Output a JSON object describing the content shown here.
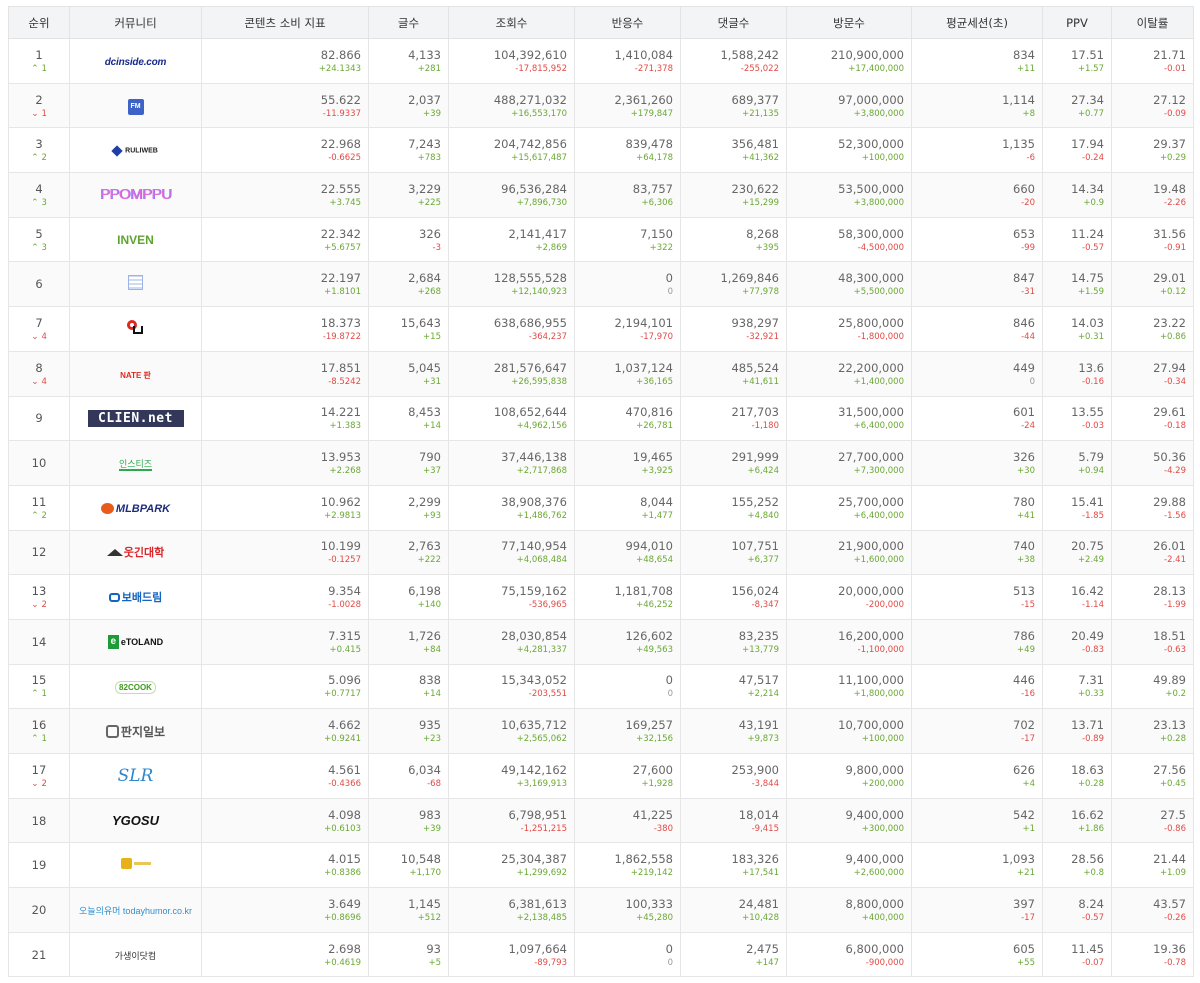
{
  "headers": [
    "순위",
    "커뮤니티",
    "콘텐츠 소비 지표",
    "글수",
    "조회수",
    "반응수",
    "댓글수",
    "방문수",
    "평균세션(초)",
    "PPV",
    "이탈률"
  ],
  "rows": [
    {
      "rank": "1",
      "chg": "1",
      "dir": "up",
      "logo": "dcinside.com",
      "vals": [
        [
          "82.866",
          "+24.1343",
          "u"
        ],
        [
          "4,133",
          "+281",
          "u"
        ],
        [
          "104,392,610",
          "-17,815,952",
          "d"
        ],
        [
          "1,410,084",
          "-271,378",
          "d"
        ],
        [
          "1,588,242",
          "-255,022",
          "d"
        ],
        [
          "210,900,000",
          "+17,400,000",
          "u"
        ],
        [
          "834",
          "+11",
          "u"
        ],
        [
          "17.51",
          "+1.57",
          "u"
        ],
        [
          "21.71",
          "-0.01",
          "d"
        ]
      ]
    },
    {
      "rank": "2",
      "chg": "1",
      "dir": "dn",
      "logo": "FM",
      "vals": [
        [
          "55.622",
          "-11.9337",
          "d"
        ],
        [
          "2,037",
          "+39",
          "u"
        ],
        [
          "488,271,032",
          "+16,553,170",
          "u"
        ],
        [
          "2,361,260",
          "+179,847",
          "u"
        ],
        [
          "689,377",
          "+21,135",
          "u"
        ],
        [
          "97,000,000",
          "+3,800,000",
          "u"
        ],
        [
          "1,114",
          "+8",
          "u"
        ],
        [
          "27.34",
          "+0.77",
          "u"
        ],
        [
          "27.12",
          "-0.09",
          "d"
        ]
      ]
    },
    {
      "rank": "3",
      "chg": "2",
      "dir": "up",
      "logo": "RULIWEB",
      "vals": [
        [
          "22.968",
          "-0.6625",
          "d"
        ],
        [
          "7,243",
          "+783",
          "u"
        ],
        [
          "204,742,856",
          "+15,617,487",
          "u"
        ],
        [
          "839,478",
          "+64,178",
          "u"
        ],
        [
          "356,481",
          "+41,362",
          "u"
        ],
        [
          "52,300,000",
          "+100,000",
          "u"
        ],
        [
          "1,135",
          "-6",
          "d"
        ],
        [
          "17.94",
          "-0.24",
          "d"
        ],
        [
          "29.37",
          "+0.29",
          "u"
        ]
      ]
    },
    {
      "rank": "4",
      "chg": "3",
      "dir": "up",
      "logo": "PPOMPPU",
      "vals": [
        [
          "22.555",
          "+3.745",
          "u"
        ],
        [
          "3,229",
          "+225",
          "u"
        ],
        [
          "96,536,284",
          "+7,896,730",
          "u"
        ],
        [
          "83,757",
          "+6,306",
          "u"
        ],
        [
          "230,622",
          "+15,299",
          "u"
        ],
        [
          "53,500,000",
          "+3,800,000",
          "u"
        ],
        [
          "660",
          "-20",
          "d"
        ],
        [
          "14.34",
          "+0.9",
          "u"
        ],
        [
          "19.48",
          "-2.26",
          "d"
        ]
      ]
    },
    {
      "rank": "5",
      "chg": "3",
      "dir": "up",
      "logo": "INVEN",
      "vals": [
        [
          "22.342",
          "+5.6757",
          "u"
        ],
        [
          "326",
          "-3",
          "d"
        ],
        [
          "2,141,417",
          "+2,869",
          "u"
        ],
        [
          "7,150",
          "+322",
          "u"
        ],
        [
          "8,268",
          "+395",
          "u"
        ],
        [
          "58,300,000",
          "-4,500,000",
          "d"
        ],
        [
          "653",
          "-99",
          "d"
        ],
        [
          "11.24",
          "-0.57",
          "d"
        ],
        [
          "31.56",
          "-0.91",
          "d"
        ]
      ]
    },
    {
      "rank": "6",
      "chg": "",
      "dir": "",
      "logo": "",
      "vals": [
        [
          "22.197",
          "+1.8101",
          "u"
        ],
        [
          "2,684",
          "+268",
          "u"
        ],
        [
          "128,555,528",
          "+12,140,923",
          "u"
        ],
        [
          "0",
          "0",
          "z"
        ],
        [
          "1,269,846",
          "+77,978",
          "u"
        ],
        [
          "48,300,000",
          "+5,500,000",
          "u"
        ],
        [
          "847",
          "-31",
          "d"
        ],
        [
          "14.75",
          "+1.59",
          "u"
        ],
        [
          "29.01",
          "+0.12",
          "u"
        ]
      ]
    },
    {
      "rank": "7",
      "chg": "4",
      "dir": "dn",
      "logo": "",
      "vals": [
        [
          "18.373",
          "-19.8722",
          "d"
        ],
        [
          "15,643",
          "+15",
          "u"
        ],
        [
          "638,686,955",
          "-364,237",
          "d"
        ],
        [
          "2,194,101",
          "-17,970",
          "d"
        ],
        [
          "938,297",
          "-32,921",
          "d"
        ],
        [
          "25,800,000",
          "-1,800,000",
          "d"
        ],
        [
          "846",
          "-44",
          "d"
        ],
        [
          "14.03",
          "+0.31",
          "u"
        ],
        [
          "23.22",
          "+0.86",
          "u"
        ]
      ]
    },
    {
      "rank": "8",
      "chg": "4",
      "dir": "dn",
      "logo": "NATE 판",
      "vals": [
        [
          "17.851",
          "-8.5242",
          "d"
        ],
        [
          "5,045",
          "+31",
          "u"
        ],
        [
          "281,576,647",
          "+26,595,838",
          "u"
        ],
        [
          "1,037,124",
          "+36,165",
          "u"
        ],
        [
          "485,524",
          "+41,611",
          "u"
        ],
        [
          "22,200,000",
          "+1,400,000",
          "u"
        ],
        [
          "449",
          "0",
          "z"
        ],
        [
          "13.6",
          "-0.16",
          "d"
        ],
        [
          "27.94",
          "-0.34",
          "d"
        ]
      ]
    },
    {
      "rank": "9",
      "chg": "",
      "dir": "",
      "logo": "CLIEN.net",
      "vals": [
        [
          "14.221",
          "+1.383",
          "u"
        ],
        [
          "8,453",
          "+14",
          "u"
        ],
        [
          "108,652,644",
          "+4,962,156",
          "u"
        ],
        [
          "470,816",
          "+26,781",
          "u"
        ],
        [
          "217,703",
          "-1,180",
          "d"
        ],
        [
          "31,500,000",
          "+6,400,000",
          "u"
        ],
        [
          "601",
          "-24",
          "d"
        ],
        [
          "13.55",
          "-0.03",
          "d"
        ],
        [
          "29.61",
          "-0.18",
          "d"
        ]
      ]
    },
    {
      "rank": "10",
      "chg": "",
      "dir": "",
      "logo": "인스티즈",
      "vals": [
        [
          "13.953",
          "+2.268",
          "u"
        ],
        [
          "790",
          "+37",
          "u"
        ],
        [
          "37,446,138",
          "+2,717,868",
          "u"
        ],
        [
          "19,465",
          "+3,925",
          "u"
        ],
        [
          "291,999",
          "+6,424",
          "u"
        ],
        [
          "27,700,000",
          "+7,300,000",
          "u"
        ],
        [
          "326",
          "+30",
          "u"
        ],
        [
          "5.79",
          "+0.94",
          "u"
        ],
        [
          "50.36",
          "-4.29",
          "d"
        ]
      ]
    },
    {
      "rank": "11",
      "chg": "2",
      "dir": "up",
      "logo": "MLBPARK",
      "vals": [
        [
          "10.962",
          "+2.9813",
          "u"
        ],
        [
          "2,299",
          "+93",
          "u"
        ],
        [
          "38,908,376",
          "+1,486,762",
          "u"
        ],
        [
          "8,044",
          "+1,477",
          "u"
        ],
        [
          "155,252",
          "+4,840",
          "u"
        ],
        [
          "25,700,000",
          "+6,400,000",
          "u"
        ],
        [
          "780",
          "+41",
          "u"
        ],
        [
          "15.41",
          "-1.85",
          "d"
        ],
        [
          "29.88",
          "-1.56",
          "d"
        ]
      ]
    },
    {
      "rank": "12",
      "chg": "",
      "dir": "",
      "logo": "웃긴대학",
      "vals": [
        [
          "10.199",
          "-0.1257",
          "d"
        ],
        [
          "2,763",
          "+222",
          "u"
        ],
        [
          "77,140,954",
          "+4,068,484",
          "u"
        ],
        [
          "994,010",
          "+48,654",
          "u"
        ],
        [
          "107,751",
          "+6,377",
          "u"
        ],
        [
          "21,900,000",
          "+1,600,000",
          "u"
        ],
        [
          "740",
          "+38",
          "u"
        ],
        [
          "20.75",
          "+2.49",
          "u"
        ],
        [
          "26.01",
          "-2.41",
          "d"
        ]
      ]
    },
    {
      "rank": "13",
      "chg": "2",
      "dir": "dn",
      "logo": "보배드림",
      "vals": [
        [
          "9.354",
          "-1.0028",
          "d"
        ],
        [
          "6,198",
          "+140",
          "u"
        ],
        [
          "75,159,162",
          "-536,965",
          "d"
        ],
        [
          "1,181,708",
          "+46,252",
          "u"
        ],
        [
          "156,024",
          "-8,347",
          "d"
        ],
        [
          "20,000,000",
          "-200,000",
          "d"
        ],
        [
          "513",
          "-15",
          "d"
        ],
        [
          "16.42",
          "-1.14",
          "d"
        ],
        [
          "28.13",
          "-1.99",
          "d"
        ]
      ]
    },
    {
      "rank": "14",
      "chg": "",
      "dir": "",
      "logo": "eTOLAND",
      "vals": [
        [
          "7.315",
          "+0.415",
          "u"
        ],
        [
          "1,726",
          "+84",
          "u"
        ],
        [
          "28,030,854",
          "+4,281,337",
          "u"
        ],
        [
          "126,602",
          "+49,563",
          "u"
        ],
        [
          "83,235",
          "+13,779",
          "u"
        ],
        [
          "16,200,000",
          "-1,100,000",
          "d"
        ],
        [
          "786",
          "+49",
          "u"
        ],
        [
          "20.49",
          "-0.83",
          "d"
        ],
        [
          "18.51",
          "-0.63",
          "d"
        ]
      ]
    },
    {
      "rank": "15",
      "chg": "1",
      "dir": "up",
      "logo": "82COOK",
      "vals": [
        [
          "5.096",
          "+0.7717",
          "u"
        ],
        [
          "838",
          "+14",
          "u"
        ],
        [
          "15,343,052",
          "-203,551",
          "d"
        ],
        [
          "0",
          "0",
          "z"
        ],
        [
          "47,517",
          "+2,214",
          "u"
        ],
        [
          "11,100,000",
          "+1,800,000",
          "u"
        ],
        [
          "446",
          "-16",
          "d"
        ],
        [
          "7.31",
          "+0.33",
          "u"
        ],
        [
          "49.89",
          "+0.2",
          "u"
        ]
      ]
    },
    {
      "rank": "16",
      "chg": "1",
      "dir": "up",
      "logo": "판지일보",
      "vals": [
        [
          "4.662",
          "+0.9241",
          "u"
        ],
        [
          "935",
          "+23",
          "u"
        ],
        [
          "10,635,712",
          "+2,565,062",
          "u"
        ],
        [
          "169,257",
          "+32,156",
          "u"
        ],
        [
          "43,191",
          "+9,873",
          "u"
        ],
        [
          "10,700,000",
          "+100,000",
          "u"
        ],
        [
          "702",
          "-17",
          "d"
        ],
        [
          "13.71",
          "-0.89",
          "d"
        ],
        [
          "23.13",
          "+0.28",
          "u"
        ]
      ]
    },
    {
      "rank": "17",
      "chg": "2",
      "dir": "dn",
      "logo": "SLR",
      "vals": [
        [
          "4.561",
          "-0.4366",
          "d"
        ],
        [
          "6,034",
          "-68",
          "d"
        ],
        [
          "49,142,162",
          "+3,169,913",
          "u"
        ],
        [
          "27,600",
          "+1,928",
          "u"
        ],
        [
          "253,900",
          "-3,844",
          "d"
        ],
        [
          "9,800,000",
          "+200,000",
          "u"
        ],
        [
          "626",
          "+4",
          "u"
        ],
        [
          "18.63",
          "+0.28",
          "u"
        ],
        [
          "27.56",
          "+0.45",
          "u"
        ]
      ]
    },
    {
      "rank": "18",
      "chg": "",
      "dir": "",
      "logo": "YGOSU",
      "vals": [
        [
          "4.098",
          "+0.6103",
          "u"
        ],
        [
          "983",
          "+39",
          "u"
        ],
        [
          "6,798,951",
          "-1,251,215",
          "d"
        ],
        [
          "41,225",
          "-380",
          "d"
        ],
        [
          "18,014",
          "-9,415",
          "d"
        ],
        [
          "9,400,000",
          "+300,000",
          "u"
        ],
        [
          "542",
          "+1",
          "u"
        ],
        [
          "16.62",
          "+1.86",
          "u"
        ],
        [
          "27.5",
          "-0.86",
          "d"
        ]
      ]
    },
    {
      "rank": "19",
      "chg": "",
      "dir": "",
      "logo": "",
      "vals": [
        [
          "4.015",
          "+0.8386",
          "u"
        ],
        [
          "10,548",
          "+1,170",
          "u"
        ],
        [
          "25,304,387",
          "+1,299,692",
          "u"
        ],
        [
          "1,862,558",
          "+219,142",
          "u"
        ],
        [
          "183,326",
          "+17,541",
          "u"
        ],
        [
          "9,400,000",
          "+2,600,000",
          "u"
        ],
        [
          "1,093",
          "+21",
          "u"
        ],
        [
          "28.56",
          "+0.8",
          "u"
        ],
        [
          "21.44",
          "+1.09",
          "u"
        ]
      ]
    },
    {
      "rank": "20",
      "chg": "",
      "dir": "",
      "logo": "오늘의유머 todayhumor.co.kr",
      "vals": [
        [
          "3.649",
          "+0.8696",
          "u"
        ],
        [
          "1,145",
          "+512",
          "u"
        ],
        [
          "6,381,613",
          "+2,138,485",
          "u"
        ],
        [
          "100,333",
          "+45,280",
          "u"
        ],
        [
          "24,481",
          "+10,428",
          "u"
        ],
        [
          "8,800,000",
          "+400,000",
          "u"
        ],
        [
          "397",
          "-17",
          "d"
        ],
        [
          "8.24",
          "-0.57",
          "d"
        ],
        [
          "43.57",
          "-0.26",
          "d"
        ]
      ]
    },
    {
      "rank": "21",
      "chg": "",
      "dir": "",
      "logo": "가생이닷컴",
      "vals": [
        [
          "2.698",
          "+0.4619",
          "u"
        ],
        [
          "93",
          "+5",
          "u"
        ],
        [
          "1,097,664",
          "-89,793",
          "d"
        ],
        [
          "0",
          "0",
          "z"
        ],
        [
          "2,475",
          "+147",
          "u"
        ],
        [
          "6,800,000",
          "-900,000",
          "d"
        ],
        [
          "605",
          "+55",
          "u"
        ],
        [
          "11.45",
          "-0.07",
          "d"
        ],
        [
          "19.36",
          "-0.78",
          "d"
        ]
      ]
    }
  ],
  "colors": {
    "up": "#6aa833",
    "down": "#e14a46",
    "header_bg": "#f3f4f6"
  }
}
